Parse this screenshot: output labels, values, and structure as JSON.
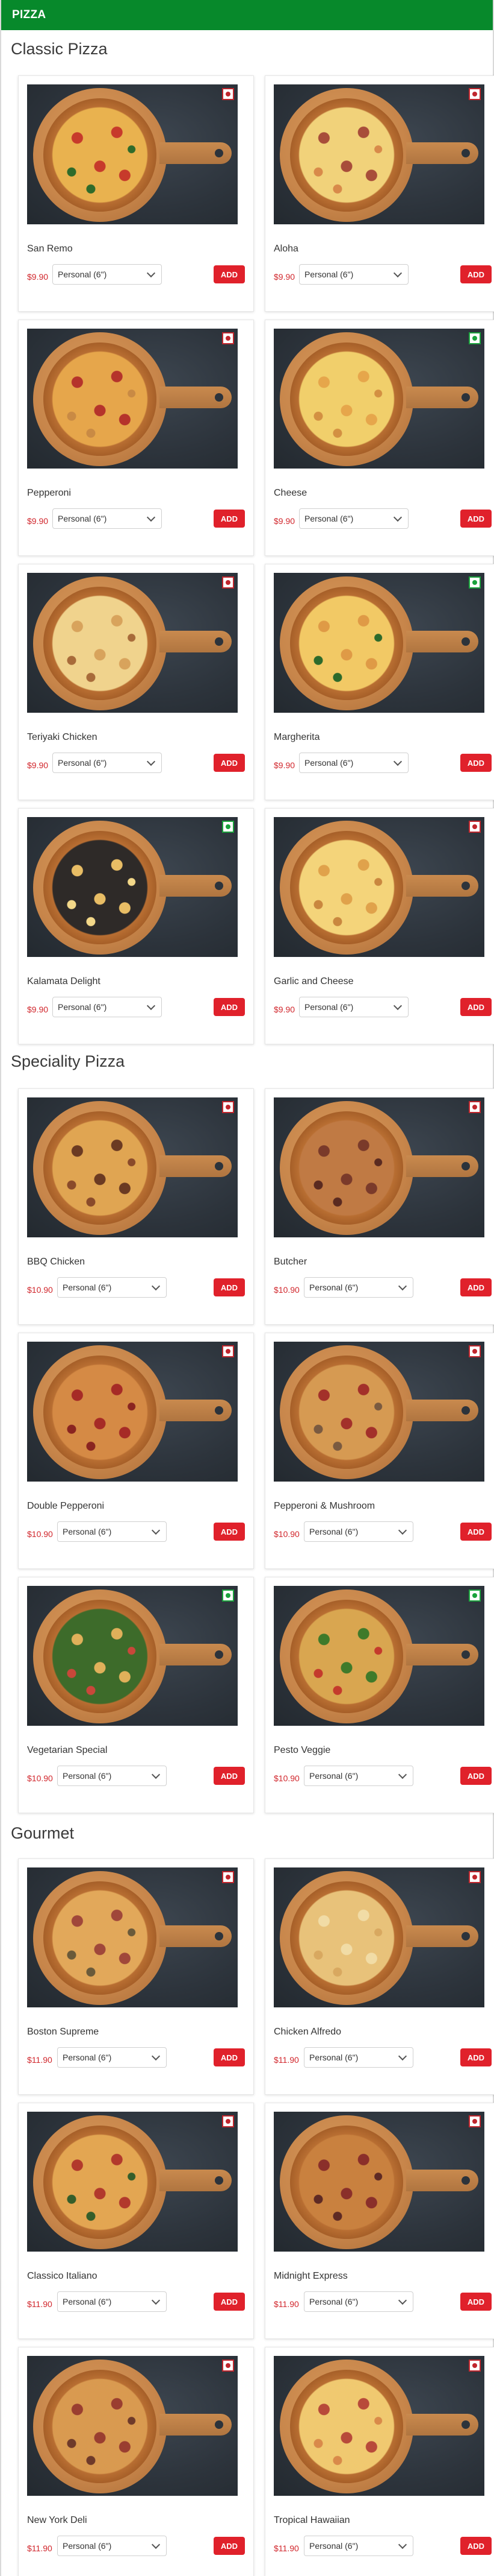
{
  "header": {
    "title": "PIZZA"
  },
  "sections": [
    {
      "title": "Classic Pizza",
      "items": [
        {
          "name": "San Remo",
          "price": "$9.90",
          "size": "Personal (6\")",
          "veg": false,
          "add": "ADD",
          "colors": [
            "#c73a2b",
            "#e9b24f",
            "#2f6b2a"
          ]
        },
        {
          "name": "Aloha",
          "price": "$9.90",
          "size": "Personal (6\")",
          "veg": false,
          "add": "ADD",
          "colors": [
            "#a84d3a",
            "#f1d27a",
            "#d88a4a"
          ]
        },
        {
          "name": "Pepperoni",
          "price": "$9.90",
          "size": "Personal (6\")",
          "veg": false,
          "add": "ADD",
          "colors": [
            "#b5332b",
            "#e6a64b",
            "#c98a44"
          ]
        },
        {
          "name": "Cheese",
          "price": "$9.90",
          "size": "Personal (6\")",
          "veg": true,
          "add": "ADD",
          "colors": [
            "#e6a64b",
            "#f1cf6b",
            "#d39042"
          ]
        },
        {
          "name": "Teriyaki Chicken",
          "price": "$9.90",
          "size": "Personal (6\")",
          "veg": false,
          "add": "ADD",
          "colors": [
            "#d8a35c",
            "#f0d38d",
            "#a86b3a"
          ]
        },
        {
          "name": "Margherita",
          "price": "$9.90",
          "size": "Personal (6\")",
          "veg": true,
          "add": "ADD",
          "colors": [
            "#df9a46",
            "#f2c965",
            "#2d6a2b"
          ]
        },
        {
          "name": "Kalamata Delight",
          "price": "$9.90",
          "size": "Personal (6\")",
          "veg": true,
          "add": "ADD",
          "colors": [
            "#e8bd65",
            "#2e2a28",
            "#f3d889"
          ]
        },
        {
          "name": "Garlic and Cheese",
          "price": "$9.90",
          "size": "Personal (6\")",
          "veg": false,
          "add": "ADD",
          "colors": [
            "#e0a24b",
            "#f4d47a",
            "#c9873f"
          ]
        }
      ]
    },
    {
      "title": "Speciality Pizza",
      "items": [
        {
          "name": "BBQ Chicken",
          "price": "$10.90",
          "size": "Personal (6\")",
          "veg": false,
          "add": "ADD",
          "colors": [
            "#6b3a22",
            "#e0a552",
            "#8a4a2a"
          ]
        },
        {
          "name": "Butcher",
          "price": "$10.90",
          "size": "Personal (6\")",
          "veg": false,
          "add": "ADD",
          "colors": [
            "#7a3a2a",
            "#c07a44",
            "#5a2a20"
          ]
        },
        {
          "name": "Double Pepperoni",
          "price": "$10.90",
          "size": "Personal (6\")",
          "veg": false,
          "add": "ADD",
          "colors": [
            "#a62b26",
            "#d58a45",
            "#8a2420"
          ]
        },
        {
          "name": "Pepperoni & Mushroom",
          "price": "$10.90",
          "size": "Personal (6\")",
          "veg": false,
          "add": "ADD",
          "colors": [
            "#a3302a",
            "#d69a52",
            "#7a5a40"
          ]
        },
        {
          "name": "Vegetarian Special",
          "price": "$10.90",
          "size": "Personal (6\")",
          "veg": true,
          "add": "ADD",
          "colors": [
            "#e0b05a",
            "#3d6b2a",
            "#c9473a"
          ]
        },
        {
          "name": "Pesto Veggie",
          "price": "$10.90",
          "size": "Personal (6\")",
          "veg": true,
          "add": "ADD",
          "colors": [
            "#3f7a2a",
            "#d9a650",
            "#c43a2c"
          ]
        }
      ]
    },
    {
      "title": "Gourmet",
      "items": [
        {
          "name": "Boston Supreme",
          "price": "$11.90",
          "size": "Personal (6\")",
          "veg": false,
          "add": "ADD",
          "colors": [
            "#a0473a",
            "#e2a85a",
            "#6a5a3a"
          ]
        },
        {
          "name": "Chicken Alfredo",
          "price": "$11.90",
          "size": "Personal (6\")",
          "veg": false,
          "add": "ADD",
          "colors": [
            "#f1dca6",
            "#e8c27a",
            "#d8a860"
          ]
        },
        {
          "name": "Classico Italiano",
          "price": "$11.90",
          "size": "Personal (6\")",
          "veg": false,
          "add": "ADD",
          "colors": [
            "#b2392c",
            "#e3a652",
            "#355e2a"
          ]
        },
        {
          "name": "Midnight Express",
          "price": "$11.90",
          "size": "Personal (6\")",
          "veg": false,
          "add": "ADD",
          "colors": [
            "#8a2f2a",
            "#c9813f",
            "#5e2a24"
          ]
        },
        {
          "name": "New York Deli",
          "price": "$11.90",
          "size": "Personal (6\")",
          "veg": false,
          "add": "ADD",
          "colors": [
            "#9a3e30",
            "#d99a50",
            "#6e3a2a"
          ]
        },
        {
          "name": "Tropical Hawaiian",
          "price": "$11.90",
          "size": "Personal (6\")",
          "veg": false,
          "add": "ADD",
          "colors": [
            "#b84a3a",
            "#f0c970",
            "#d98a4a"
          ]
        }
      ]
    }
  ]
}
